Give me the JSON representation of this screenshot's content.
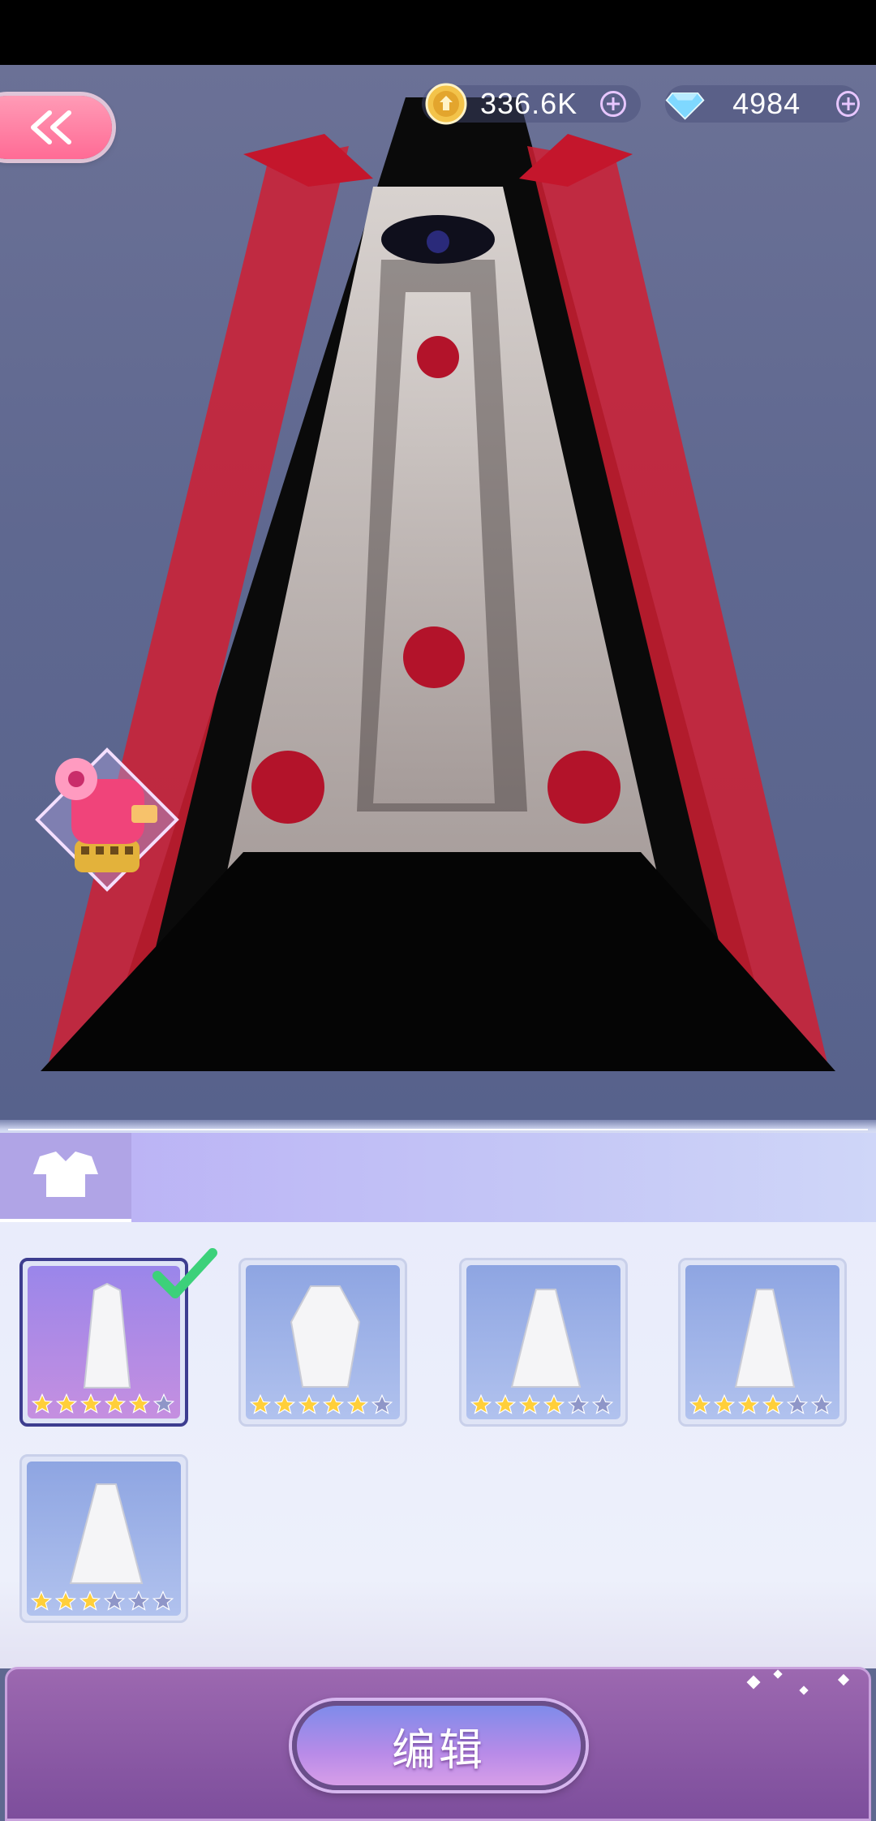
{
  "currency": {
    "gold": {
      "icon": "gold-coin-icon",
      "value": "336.6K"
    },
    "diamond": {
      "icon": "diamond-icon",
      "value": "4984"
    }
  },
  "tabs": [
    {
      "name": "dress-category-tab",
      "icon": "dress-silhouette-icon",
      "active": true
    }
  ],
  "items": [
    {
      "name": "white-gown-gold-trim",
      "stars": 5,
      "max_stars": 6,
      "selected": true
    },
    {
      "name": "white-robe-long-sleeves",
      "stars": 5,
      "max_stars": 6,
      "selected": false
    },
    {
      "name": "white-ruffle-gown",
      "stars": 4,
      "max_stars": 6,
      "selected": false
    },
    {
      "name": "white-strapless-gown",
      "stars": 4,
      "max_stars": 6,
      "selected": false
    },
    {
      "name": "white-ballgown-sleeves",
      "stars": 3,
      "max_stars": 6,
      "selected": false
    }
  ],
  "actions": {
    "edit_label": "编辑"
  },
  "colors": {
    "accent_pink": "#ff6b95",
    "star_gold": "#ffcf3a",
    "star_empty": "#8f96c8",
    "panel": "#e9ecfb"
  }
}
